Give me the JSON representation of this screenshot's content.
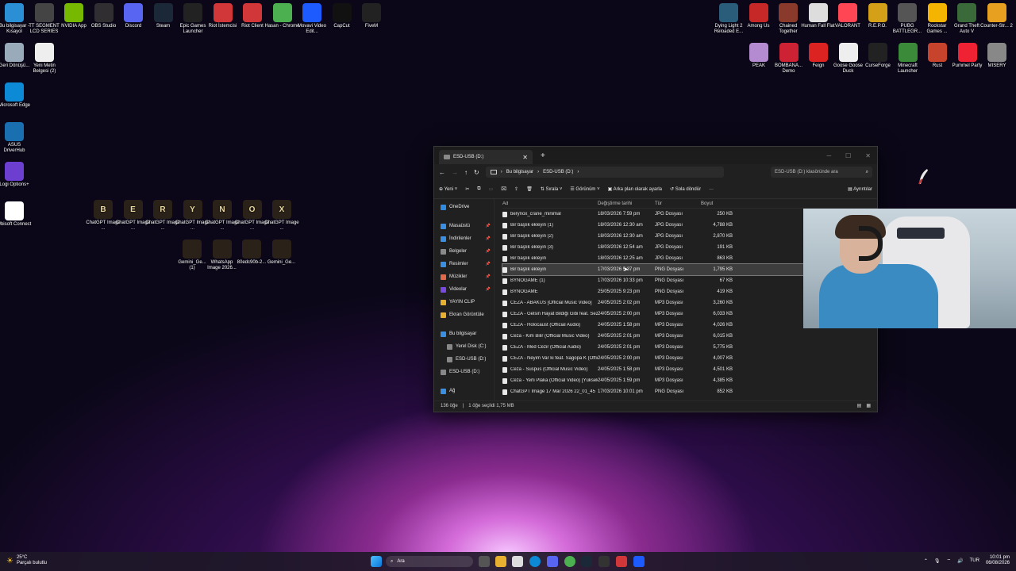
{
  "desktop_icons_top_left": [
    {
      "label": "Bu bilgisayar - Kısayol",
      "color": "#2b8fd6",
      "icon": "computer-icon"
    },
    {
      "label": "TT SEGMENT LCD SERIES",
      "color": "#444",
      "icon": "tt-icon"
    },
    {
      "label": "NVIDIA App",
      "color": "#76b900",
      "icon": "nvidia-icon"
    },
    {
      "label": "OBS Studio",
      "color": "#302e31",
      "icon": "obs-icon"
    },
    {
      "label": "Discord",
      "color": "#5865f2",
      "icon": "discord-icon"
    },
    {
      "label": "Steam",
      "color": "#1b2838",
      "icon": "steam-icon"
    },
    {
      "label": "Epic Games Launcher",
      "color": "#222",
      "icon": "epic-icon"
    },
    {
      "label": "Riot İstemcisi",
      "color": "#d13639",
      "icon": "riot-icon"
    },
    {
      "label": "Riot Client",
      "color": "#d13639",
      "icon": "riot-icon"
    },
    {
      "label": "Hasan - Chrome",
      "color": "#4caf50",
      "icon": "chrome-icon"
    },
    {
      "label": "Movavi Video Edit...",
      "color": "#1e5bff",
      "icon": "movavi-icon"
    },
    {
      "label": "CapCut",
      "color": "#111",
      "icon": "capcut-icon"
    },
    {
      "label": "FiveM",
      "color": "#222",
      "icon": "fivem-icon"
    }
  ],
  "desktop_icons_left_col": [
    {
      "label": "Geri Dönüşü...",
      "color": "#9ab",
      "icon": "recycle-bin-icon"
    },
    {
      "label": "Yeni Metin Belgesi (2)",
      "color": "#eee",
      "icon": "text-doc-icon"
    },
    {
      "label": "Microsoft Edge",
      "color": "#0c8ad6",
      "icon": "edge-icon"
    },
    {
      "label": "ASUS DriverHub",
      "color": "#1a6fb0",
      "icon": "asus-icon"
    },
    {
      "label": "Logi Options+",
      "color": "#6c3fd1",
      "icon": "logi-icon"
    },
    {
      "label": "Ubisoft Connect",
      "color": "#fff",
      "icon": "ubisoft-icon"
    }
  ],
  "desktop_icons_mid_row1": [
    {
      "label": "ChatGPT Image ...",
      "glyph": "B"
    },
    {
      "label": "ChatGPT Image ...",
      "glyph": "E"
    },
    {
      "label": "ChatGPT Image ...",
      "glyph": "R"
    },
    {
      "label": "ChatGPT Image ...",
      "glyph": "Y"
    },
    {
      "label": "ChatGPT Image ...",
      "glyph": "N"
    },
    {
      "label": "ChatGPT Image ...",
      "glyph": "O"
    },
    {
      "label": "ChatGPT Image ...",
      "glyph": "X"
    }
  ],
  "desktop_icons_mid_row2": [
    {
      "label": "Gemini_Ge... (1)"
    },
    {
      "label": "WhatsApp Image 2026..."
    },
    {
      "label": "80edc90b-2..."
    },
    {
      "label": "Gemini_Ge..."
    }
  ],
  "desktop_icons_top_right": [
    {
      "label": "Dying Light 2 Reloaded E...",
      "color": "#2a5d7a"
    },
    {
      "label": "Among Us",
      "color": "#c62828"
    },
    {
      "label": "Chained Together",
      "color": "#8a3a2a"
    },
    {
      "label": "Human Fall Flat",
      "color": "#ddd"
    },
    {
      "label": "VALORANT",
      "color": "#ff4655"
    },
    {
      "label": "R.E.P.O.",
      "color": "#d4a017"
    },
    {
      "label": "PUBG BATTLEGR...",
      "color": "#555"
    },
    {
      "label": "Rockstar Games ...",
      "color": "#f5b400"
    },
    {
      "label": "Grand Theft Auto V",
      "color": "#3a6a3a"
    },
    {
      "label": "Counter-Str... 2",
      "color": "#e8a020"
    }
  ],
  "desktop_icons_right_row2": [
    {
      "label": "PEAK",
      "color": "#b48ad0"
    },
    {
      "label": "BOMBANA... Demo",
      "color": "#c23"
    },
    {
      "label": "Feign",
      "color": "#d22"
    },
    {
      "label": "Goose Goose Duck",
      "color": "#eee"
    },
    {
      "label": "CurseForge",
      "color": "#222"
    },
    {
      "label": "Minecraft Launcher",
      "color": "#3a8a3a"
    },
    {
      "label": "Rust",
      "color": "#c8432b"
    },
    {
      "label": "Pummel Party",
      "color": "#e23"
    },
    {
      "label": "MISERY",
      "color": "#888"
    }
  ],
  "explorer": {
    "tab_title": "ESD-USB (D:)",
    "breadcrumb": [
      "Bu bilgisayar",
      "ESD-USB (D:)"
    ],
    "search_placeholder": "ESD-USB (D:) klasöründe ara",
    "commands": {
      "new": "Yeni",
      "sort": "Sırala",
      "view": "Görünüm",
      "set_bg": "Arka plan olarak ayarla",
      "rotate_left": "Sola döndür",
      "details": "Ayrıntılar"
    },
    "nav": [
      {
        "label": "OneDrive",
        "color": "#2f8ae0"
      },
      {
        "label": "Masaüstü",
        "color": "#3b8ee0",
        "pin": "📌"
      },
      {
        "label": "İndirilenler",
        "color": "#3b8ee0",
        "pin": "📌"
      },
      {
        "label": "Belgeler",
        "color": "#8a8a8a",
        "pin": "📌"
      },
      {
        "label": "Resimler",
        "color": "#3b8ee0",
        "pin": "📌"
      },
      {
        "label": "Müzikler",
        "color": "#e06a4a",
        "pin": "📌"
      },
      {
        "label": "Videolar",
        "color": "#7a4ae0",
        "pin": "📌"
      },
      {
        "label": "YAYIN CLIP",
        "color": "#e8b030"
      },
      {
        "label": "Ekran Görüntüle",
        "color": "#e8b030"
      },
      {
        "label": "Bu bilgisayar",
        "color": "#3b8ee0"
      },
      {
        "label": "Yerel Disk (C:)",
        "color": "#888"
      },
      {
        "label": "ESD-USB (D:)",
        "color": "#888"
      },
      {
        "label": "ESD-USB (D:)",
        "color": "#888"
      },
      {
        "label": "Ağ",
        "color": "#3b8ee0"
      }
    ],
    "columns": {
      "name": "Ad",
      "date": "Değiştirme tarihi",
      "type": "Tür",
      "size": "Boyut"
    },
    "files": [
      {
        "name": "berynox_crane_minimal",
        "date": "18/03/2026 7:59 pm",
        "type": "JPG Dosyası",
        "size": "250 KB"
      },
      {
        "name": "Bir başlık ekleyin (1)",
        "date": "18/03/2026 12:30 am",
        "type": "JPG Dosyası",
        "size": "4,788 KB"
      },
      {
        "name": "Bir başlık ekleyin (2)",
        "date": "18/03/2026 12:30 am",
        "type": "JPG Dosyası",
        "size": "2,870 KB"
      },
      {
        "name": "Bir başlık ekleyin (3)",
        "date": "18/03/2026 12:54 am",
        "type": "JPG Dosyası",
        "size": "191 KB"
      },
      {
        "name": "Bir başlık ekleyin",
        "date": "18/03/2026 12:25 am",
        "type": "JPG Dosyası",
        "size": "863 KB"
      },
      {
        "name": "Bir başlık ekleyin",
        "date": "17/03/2026 5:37 pm",
        "type": "PNG Dosyası",
        "size": "1,795 KB",
        "selected": true
      },
      {
        "name": "BYNOGAME (1)",
        "date": "17/03/2026 10:33 pm",
        "type": "PNG Dosyası",
        "size": "67 KB"
      },
      {
        "name": "BYNOGAME",
        "date": "25/05/2025 9:23 pm",
        "type": "PNG Dosyası",
        "size": "419 KB"
      },
      {
        "name": "CEZA - ABAKÜS [Official Music Video]",
        "date": "24/05/2025 2:02 pm",
        "type": "MP3 Dosyası",
        "size": "3,260 KB"
      },
      {
        "name": "CEZA - Gelsin Hayat Bildiği Gibi feat. Sez...",
        "date": "24/05/2025 2:00 pm",
        "type": "MP3 Dosyası",
        "size": "6,033 KB"
      },
      {
        "name": "CEZA - Holocaust (Official Audio)",
        "date": "24/05/2025 1:58 pm",
        "type": "MP3 Dosyası",
        "size": "4,026 KB"
      },
      {
        "name": "Ceza - Kim Bilir (Official Music Video)",
        "date": "24/05/2025 2:01 pm",
        "type": "MP3 Dosyası",
        "size": "6,015 KB"
      },
      {
        "name": "CEZA - Med Cezir (Official Audio)",
        "date": "24/05/2025 2:01 pm",
        "type": "MP3 Dosyası",
        "size": "5,775 KB"
      },
      {
        "name": "CEZA - Neyim Var ki feat. Sagopa K (Offic...",
        "date": "24/05/2025 2:00 pm",
        "type": "MP3 Dosyası",
        "size": "4,007 KB"
      },
      {
        "name": "Ceza - Suspus (Official Music Video)",
        "date": "24/05/2025 1:58 pm",
        "type": "MP3 Dosyası",
        "size": "4,501 KB"
      },
      {
        "name": "Ceza - Yerli Plaka (Official Video) [Yüksek...",
        "date": "24/05/2025 1:59 pm",
        "type": "MP3 Dosyası",
        "size": "4,385 KB"
      },
      {
        "name": "ChatGPT Image 17 Mar 2026 22_01_45",
        "date": "17/03/2026 10:01 pm",
        "type": "PNG Dosyası",
        "size": "852 KB"
      }
    ],
    "status": {
      "count": "136 öğe",
      "selected": "1 öğe seçildi  1,75 MB"
    }
  },
  "taskbar": {
    "weather_temp": "25°C",
    "weather_text": "Parçalı bulutlu",
    "search_label": "Ara",
    "lang": "TUR",
    "time": "10:01 pm",
    "date": "06/08/2026"
  }
}
